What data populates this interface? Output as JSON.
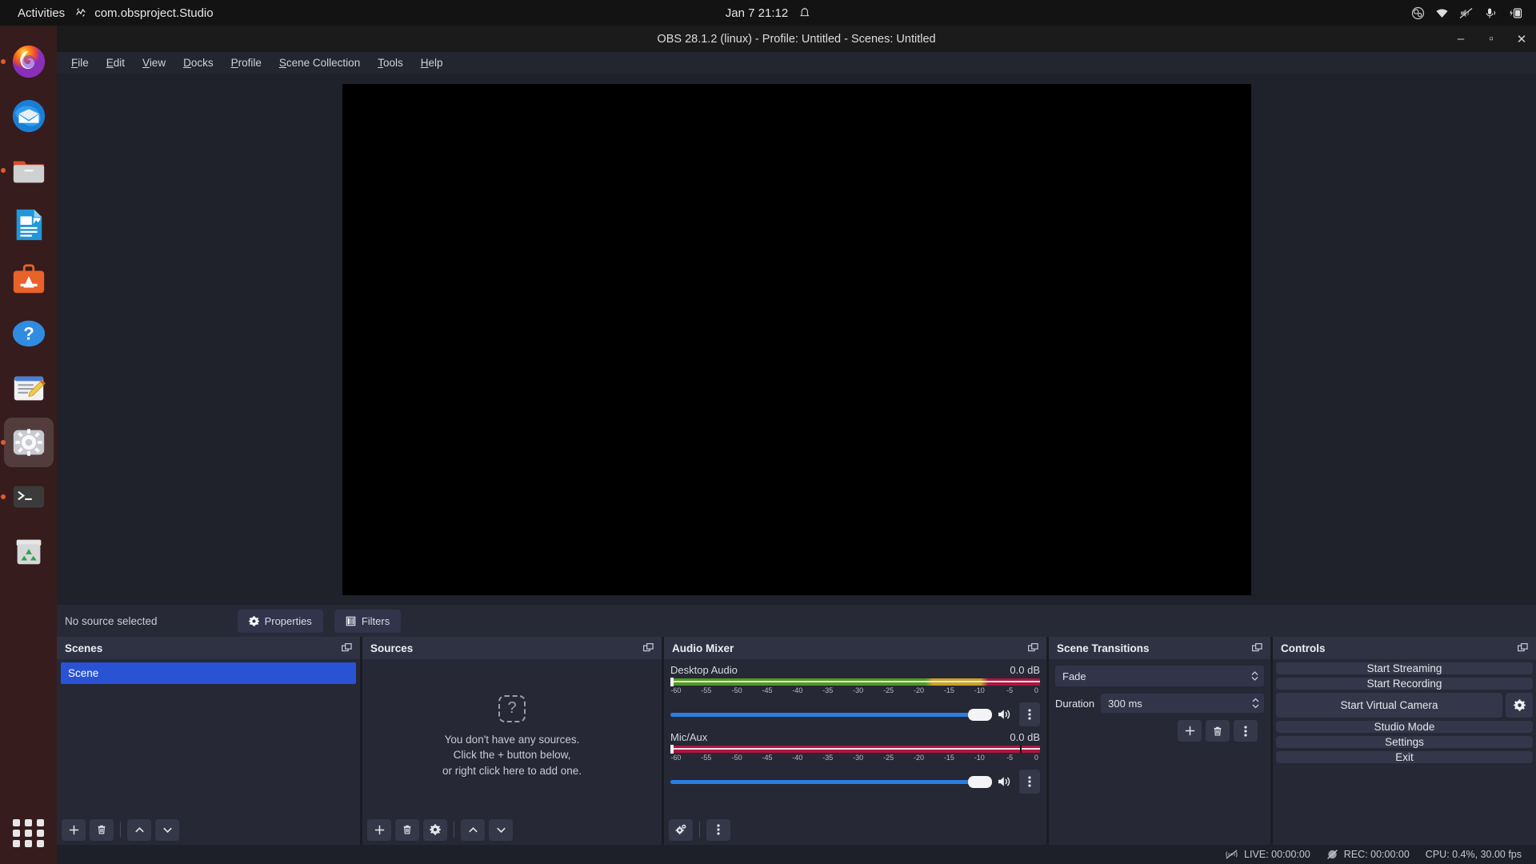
{
  "desktop": {
    "activities": "Activities",
    "app_indicator": "com.obsproject.Studio",
    "clock": "Jan 7  21:12",
    "tray_icons": [
      "obs-tray-icon",
      "wifi-icon",
      "volume-muted-icon",
      "microphone-icon",
      "battery-icon"
    ],
    "dock_items": [
      {
        "name": "firefox",
        "label": "Firefox",
        "running": true,
        "active": false
      },
      {
        "name": "thunderbird",
        "label": "Thunderbird",
        "running": false,
        "active": false
      },
      {
        "name": "files",
        "label": "Files",
        "running": true,
        "active": false
      },
      {
        "name": "libreoffice-writer",
        "label": "LibreOffice Writer",
        "running": false,
        "active": false
      },
      {
        "name": "ubuntu-software",
        "label": "Ubuntu Software",
        "running": false,
        "active": false
      },
      {
        "name": "help",
        "label": "Help",
        "running": false,
        "active": false
      },
      {
        "name": "text-editor",
        "label": "Text Editor",
        "running": false,
        "active": false
      },
      {
        "name": "settings",
        "label": "Settings",
        "running": true,
        "active": true
      },
      {
        "name": "terminal",
        "label": "Terminal",
        "running": true,
        "active": false
      },
      {
        "name": "trash",
        "label": "Trash",
        "running": false,
        "active": false
      }
    ]
  },
  "window": {
    "title": "OBS 28.1.2 (linux) - Profile: Untitled - Scenes: Untitled",
    "minimize": "–",
    "maximize": "▫",
    "close": "✕"
  },
  "menubar": [
    {
      "pre": "",
      "key": "F",
      "post": "ile"
    },
    {
      "pre": "",
      "key": "E",
      "post": "dit"
    },
    {
      "pre": "",
      "key": "V",
      "post": "iew"
    },
    {
      "pre": "",
      "key": "D",
      "post": "ocks"
    },
    {
      "pre": "",
      "key": "P",
      "post": "rofile"
    },
    {
      "pre": "",
      "key": "S",
      "post": "cene Collection"
    },
    {
      "pre": "",
      "key": "T",
      "post": "ools"
    },
    {
      "pre": "",
      "key": "H",
      "post": "elp"
    }
  ],
  "source_toolbar": {
    "status": "No source selected",
    "properties": "Properties",
    "filters": "Filters"
  },
  "scenes": {
    "title": "Scenes",
    "items": [
      {
        "label": "Scene",
        "selected": true
      }
    ]
  },
  "sources": {
    "title": "Sources",
    "empty_line1": "You don't have any sources.",
    "empty_line2": "Click the + button below,",
    "empty_line3": "or right click here to add one.",
    "empty_icon": "?"
  },
  "mixer": {
    "title": "Audio Mixer",
    "scale_labels": [
      "-60",
      "-55",
      "-50",
      "-45",
      "-40",
      "-35",
      "-30",
      "-25",
      "-20",
      "-15",
      "-10",
      "-5",
      "0"
    ],
    "channels": [
      {
        "name": "Desktop Audio",
        "db": "0.0 dB",
        "meter_style": "green-yellow-red",
        "volume_percent": 100
      },
      {
        "name": "Mic/Aux",
        "db": "0.0 dB",
        "meter_style": "red",
        "volume_percent": 100
      }
    ]
  },
  "transitions": {
    "title": "Scene Transitions",
    "selected": "Fade",
    "duration_label": "Duration",
    "duration_value": "300 ms"
  },
  "controls": {
    "title": "Controls",
    "buttons": [
      {
        "label": "Start Streaming",
        "gear": false
      },
      {
        "label": "Start Recording",
        "gear": false
      },
      {
        "label": "Start Virtual Camera",
        "gear": true
      },
      {
        "label": "Studio Mode",
        "gear": false
      },
      {
        "label": "Settings",
        "gear": false
      },
      {
        "label": "Exit",
        "gear": false
      }
    ]
  },
  "status_bar": {
    "live": "LIVE: 00:00:00",
    "rec": "REC: 00:00:00",
    "cpu": "CPU: 0.4%, 30.00 fps"
  },
  "colors": {
    "accent_blue": "#2a52d4",
    "slider_blue": "#2a7fe0",
    "panel": "#262836",
    "panel_header": "#2f3242",
    "meter_green": "#4f9c21",
    "meter_yellow": "#c9a227",
    "meter_red": "#b01440"
  }
}
